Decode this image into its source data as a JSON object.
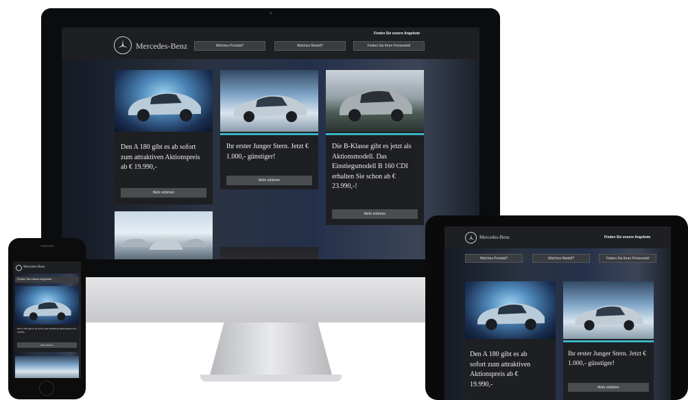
{
  "brand": {
    "name": "Mercedes-Benz"
  },
  "header": {
    "link": "Finden Sie unsere Angebote"
  },
  "nav": [
    "Welches Produkt?",
    "Welches Modell?",
    "Finden Sie Ihren Preisvorteil"
  ],
  "cards": [
    {
      "text": "Den A 180 gibt es ab sofort zum attraktiven Aktionspreis ab € 19.990,-",
      "button": "Mehr erfahren"
    },
    {
      "text": "Ihr erster Junger Stern. Jetzt € 1.000,- günstiger!",
      "button": "Mehr erfahren"
    },
    {
      "text": "Die B-Klasse gibt es jetzt als Aktionsmodell. Das Einstiegsmodell B 160 CDI erhalten Sie schon ab € 23.990,-!",
      "button": "Mehr erfahren"
    }
  ],
  "tablet_card1_text": "Den A 180 gibt es ab sofort zum attraktiven Aktionspreis ab € 19.990,-",
  "colors": {
    "header": "#1d1f23",
    "card": "#1e1f22",
    "button": "#4a4c50",
    "accent": "#3bb7c7"
  }
}
